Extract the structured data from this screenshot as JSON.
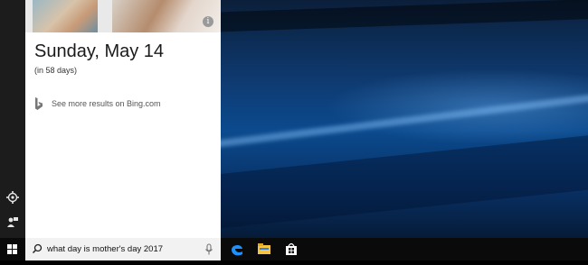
{
  "cortana": {
    "answer_date": "Sunday, May 14",
    "answer_sub": "(in 58 days)",
    "bing_link": "See more results on Bing.com"
  },
  "taskbar": {
    "search_query": "what day is mother's day 2017",
    "apps": [
      "edge-icon",
      "file-explorer-icon",
      "store-icon"
    ]
  },
  "colors": {
    "taskbar": "#0a0a0a",
    "rail": "#1c1c1c",
    "edge_blue": "#1e90ff",
    "explorer_yellow": "#f4c542"
  }
}
